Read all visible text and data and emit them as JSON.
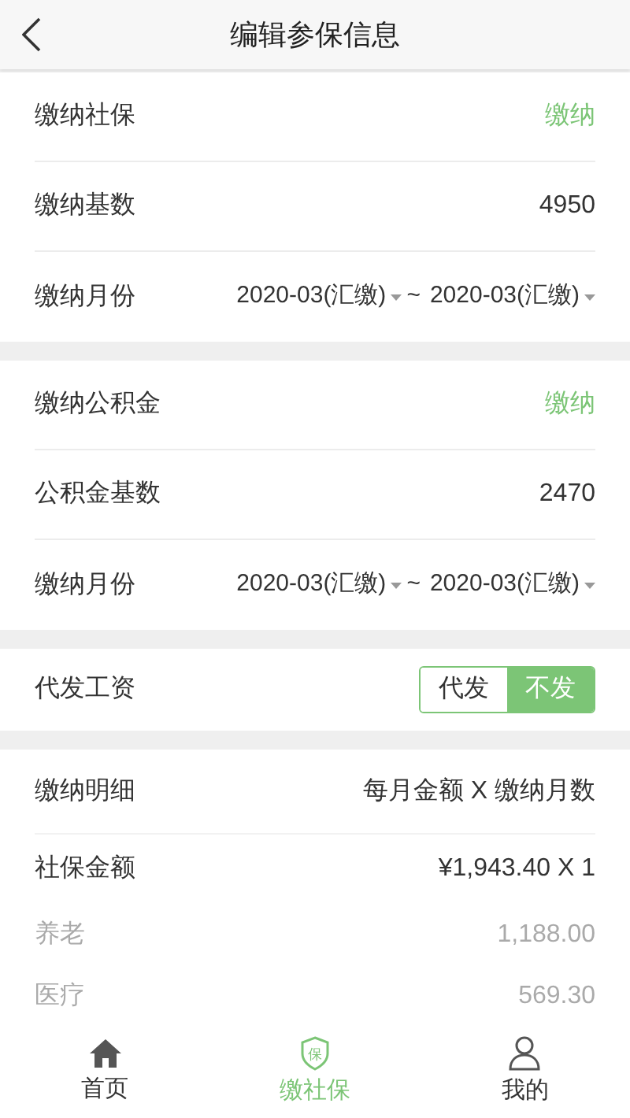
{
  "header": {
    "title": "编辑参保信息"
  },
  "sections": [
    {
      "rows": [
        {
          "kind": "status",
          "label": "缴纳社保",
          "value": "缴纳"
        },
        {
          "kind": "value",
          "label": "缴纳基数",
          "value": "4950"
        },
        {
          "kind": "range",
          "label": "缴纳月份",
          "from": "2020-03(汇缴)",
          "separator": "~",
          "to": "2020-03(汇缴)"
        }
      ]
    },
    {
      "rows": [
        {
          "kind": "status",
          "label": "缴纳公积金",
          "value": "缴纳"
        },
        {
          "kind": "value",
          "label": "公积金基数",
          "value": "2470"
        },
        {
          "kind": "range",
          "label": "缴纳月份",
          "from": "2020-03(汇缴)",
          "separator": "~",
          "to": "2020-03(汇缴)"
        }
      ]
    },
    {
      "rows": [
        {
          "kind": "segment",
          "label": "代发工资",
          "options": [
            {
              "label": "代发",
              "selected": false
            },
            {
              "label": "不发",
              "selected": true
            }
          ]
        }
      ]
    },
    {
      "rows": [
        {
          "kind": "heading",
          "label": "缴纳明细",
          "value": "每月金额 X 缴纳月数"
        },
        {
          "kind": "total",
          "label": "社保金额",
          "value": "¥1,943.40 X 1"
        },
        {
          "kind": "item",
          "label": "养老",
          "value": "1,188.00"
        },
        {
          "kind": "item",
          "label": "医疗",
          "value": "569.30"
        }
      ]
    }
  ],
  "tab_bar": [
    {
      "label": "首页",
      "kind": "home",
      "selected": false
    },
    {
      "label": "缴社保",
      "kind": "shield",
      "icon_text": "保",
      "selected": true
    },
    {
      "label": "我的",
      "kind": "person",
      "selected": false
    }
  ]
}
